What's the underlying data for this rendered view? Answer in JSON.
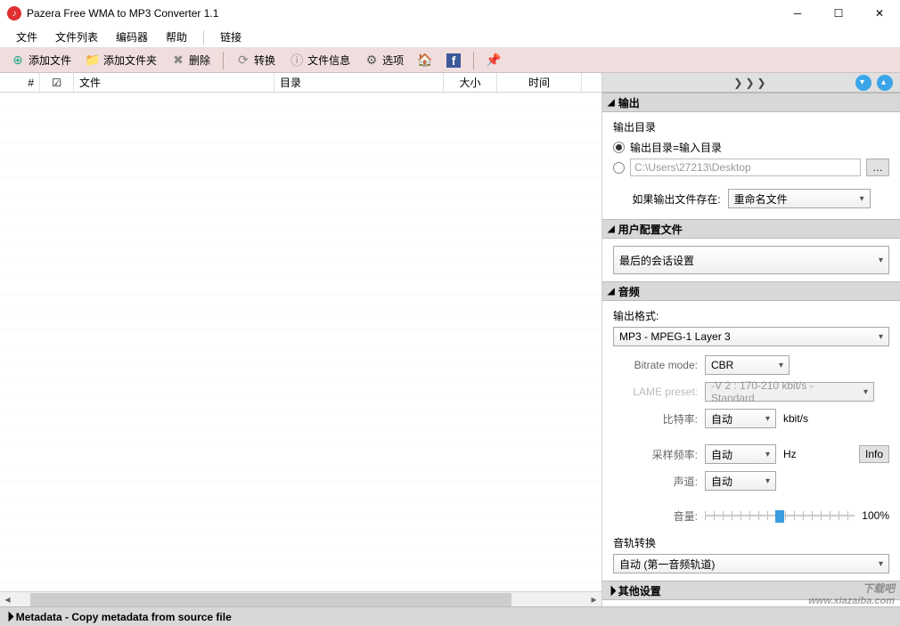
{
  "window": {
    "title": "Pazera Free WMA to MP3 Converter 1.1"
  },
  "menu": {
    "file": "文件",
    "filelist": "文件列表",
    "encoder": "编码器",
    "help": "帮助",
    "links": "链接"
  },
  "toolbar": {
    "add_file": "添加文件",
    "add_folder": "添加文件夹",
    "delete": "删除",
    "convert": "转换",
    "file_info": "文件信息",
    "options": "选项"
  },
  "table": {
    "num": "#",
    "file": "文件",
    "dir": "目录",
    "size": "大小",
    "time": "时间"
  },
  "panel": {
    "expand": "❯❯❯",
    "output": {
      "title": "输出",
      "dir_label": "输出目录",
      "same_as_input": "输出目录=输入目录",
      "path": "C:\\Users\\27213\\Desktop",
      "exists_label": "如果输出文件存在:",
      "exists_value": "重命名文件"
    },
    "profile": {
      "title": "用户配置文件",
      "value": "最后的会话设置"
    },
    "audio": {
      "title": "音频",
      "format_label": "输出格式:",
      "format_value": "MP3 - MPEG-1 Layer 3",
      "bitrate_mode_label": "Bitrate mode:",
      "bitrate_mode_value": "CBR",
      "lame_label": "LAME preset:",
      "lame_value": "-V 2 : 170-210 kbit/s - Standard",
      "bitrate_label": "比特率:",
      "bitrate_value": "自动",
      "bitrate_unit": "kbit/s",
      "sample_label": "采样频率:",
      "sample_value": "自动",
      "sample_unit": "Hz",
      "channel_label": "声道:",
      "channel_value": "自动",
      "info_btn": "Info",
      "volume_label": "音量:",
      "volume_value": "100%",
      "track_label": "音轨转换",
      "track_value": "自动 (第一音频轨道)"
    },
    "other": {
      "title": "其他设置"
    }
  },
  "bottom": {
    "metadata": "Metadata - Copy metadata from source file"
  },
  "watermark": {
    "main": "下载吧",
    "sub": "www.xiazaiba.com"
  }
}
